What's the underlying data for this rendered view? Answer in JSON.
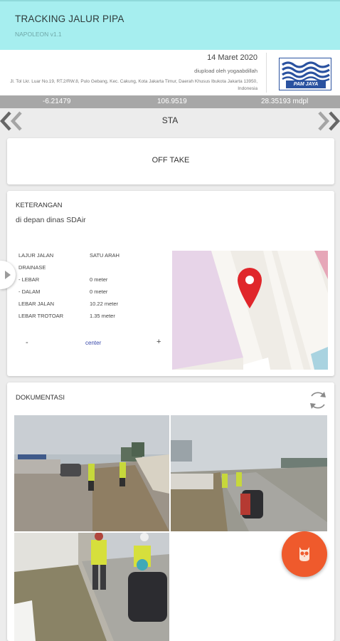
{
  "app": {
    "title": "TRACKING JALUR PIPA",
    "subtitle": "NAPOLEON v1.1"
  },
  "header": {
    "date": "14 Maret 2020",
    "uploader": "diupload oleh yogaabdillah",
    "address": "Jl. Tol Lkr. Luar No.19, RT.2/RW.8, Pulo Gebang, Kec. Cakung, Kota Jakarta Timur, Daerah Khusus Ibukota Jakarta 13950, Indonesia",
    "logo_text": "PAM JAYA",
    "logo_color": "#2a52a0"
  },
  "coords": {
    "lat": "-6.21479",
    "lng": "106.9519",
    "alt": "28.35193 mdpl"
  },
  "sta": {
    "label": "STA",
    "prev_icon": "chevron-left-icon",
    "next_icon": "chevron-right-icon"
  },
  "offtake": {
    "label": "OFF TAKE"
  },
  "keterangan": {
    "label": "KETERANGAN",
    "value": "di depan dinas SDAir",
    "rows": [
      {
        "key": "LAJUR JALAN",
        "value": "SATU ARAH"
      },
      {
        "key": "DRAINASE",
        "value": ""
      },
      {
        "key": "- LEBAR",
        "value": "0 meter"
      },
      {
        "key": "- DALAM",
        "value": "0 meter"
      },
      {
        "key": "LEBAR JALAN",
        "value": "10.22 meter"
      },
      {
        "key": "LEBAR TROTOAR",
        "value": "1.35 meter"
      }
    ],
    "zoom_out": "-",
    "center": "center",
    "zoom_in": "+"
  },
  "dokumentasi": {
    "label": "DOKUMENTASI",
    "refresh_icon": "refresh-icon"
  },
  "fab": {
    "icon": "owl-icon",
    "color": "#ef5a2c"
  },
  "colors": {
    "appbar": "#a6eeef",
    "coords_bar": "#a7a7a7",
    "marker": "#e0262b"
  }
}
